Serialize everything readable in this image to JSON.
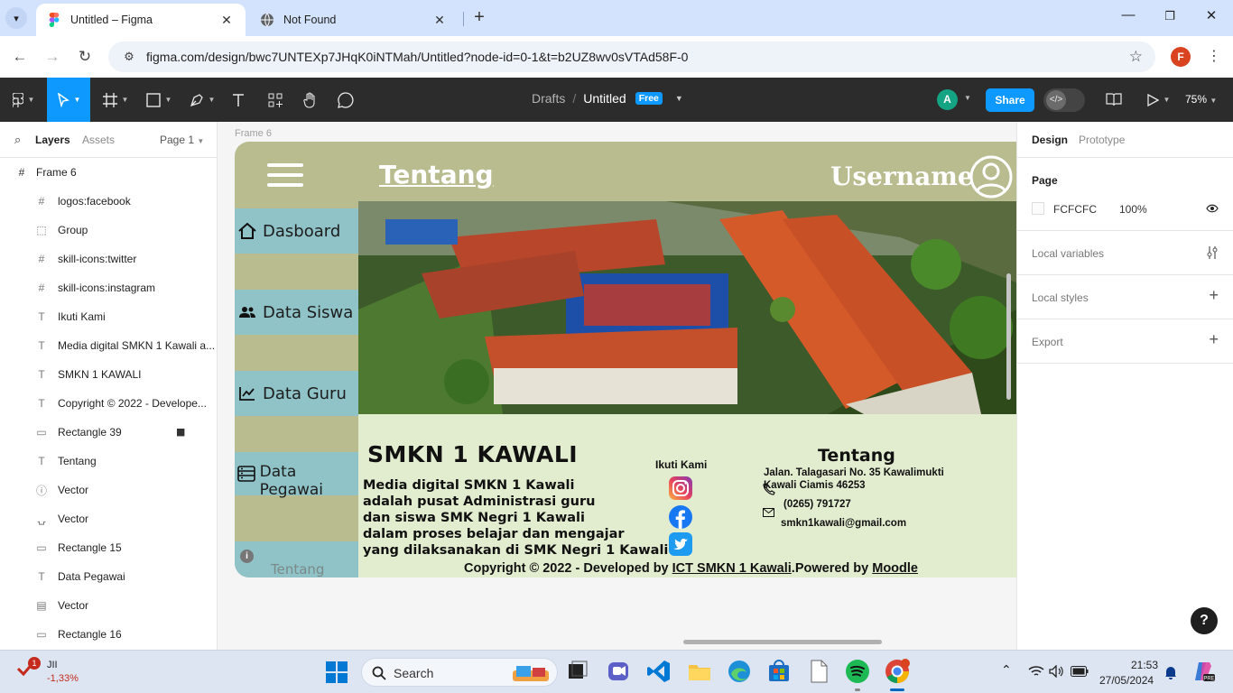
{
  "browser": {
    "tabs": [
      {
        "title": "Untitled – Figma",
        "active": true
      },
      {
        "title": "Not Found",
        "active": false
      }
    ],
    "url": "figma.com/design/bwc7UNTEXp7JHqK0iNTMah/Untitled?node-id=0-1&t=b2UZ8wv0sVTAd58F-0",
    "profile_initial": "F"
  },
  "figma_toolbar": {
    "breadcrumb_parent": "Drafts",
    "file_name": "Untitled",
    "plan_badge": "Free",
    "user_initial": "A",
    "share_label": "Share",
    "zoom": "75%"
  },
  "left_panel": {
    "tabs": {
      "layers": "Layers",
      "assets": "Assets"
    },
    "page_selector": "Page 1",
    "frame_name": "Frame 6",
    "layers": [
      {
        "icon": "frame-icon",
        "glyph": "#",
        "name": "logos:facebook"
      },
      {
        "icon": "group-icon",
        "glyph": "⬚",
        "name": "Group"
      },
      {
        "icon": "frame-icon",
        "glyph": "#",
        "name": "skill-icons:twitter"
      },
      {
        "icon": "frame-icon",
        "glyph": "#",
        "name": "skill-icons:instagram"
      },
      {
        "icon": "text-icon",
        "glyph": "T",
        "name": "Ikuti Kami"
      },
      {
        "icon": "text-icon",
        "glyph": "T",
        "name": "Media digital SMKN 1 Kawali a..."
      },
      {
        "icon": "text-icon",
        "glyph": "T",
        "name": "SMKN 1 KAWALI"
      },
      {
        "icon": "text-icon",
        "glyph": "T",
        "name": "Copyright © 2022 - Develope..."
      },
      {
        "icon": "rectangle-icon",
        "glyph": "▭",
        "name": "Rectangle 39",
        "locked": true
      },
      {
        "icon": "text-icon",
        "glyph": "T",
        "name": "Tentang"
      },
      {
        "icon": "vector-icon",
        "glyph": "ⓘ",
        "name": "Vector"
      },
      {
        "icon": "vector-icon",
        "glyph": "⍽",
        "name": "Vector"
      },
      {
        "icon": "rectangle-icon",
        "glyph": "▭",
        "name": "Rectangle 15"
      },
      {
        "icon": "text-icon",
        "glyph": "T",
        "name": "Data Pegawai"
      },
      {
        "icon": "vector-icon",
        "glyph": "▤",
        "name": "Vector"
      },
      {
        "icon": "rectangle-icon",
        "glyph": "▭",
        "name": "Rectangle 16"
      }
    ]
  },
  "canvas": {
    "frame_label": "Frame 6",
    "header": {
      "title": "Tentang",
      "username": "Username"
    },
    "menu": [
      "Dasboard",
      "Data Siswa",
      "Data Guru",
      "Data Pegawai",
      "Tentang"
    ],
    "footer": {
      "school": "SMKN 1 KAWALI",
      "description_lines": [
        "Media digital SMKN 1 Kawali",
        "adalah pusat Administrasi guru",
        "dan siswa SMK Negri 1 Kawali",
        "dalam proses belajar dan mengajar",
        "yang dilaksanakan di SMK Negri 1 Kawali"
      ],
      "follow_us": "Ikuti Kami",
      "about_heading": "Tentang",
      "address_line1": "Jalan. Talagasari No. 35 Kawalimukti",
      "address_line2": "Kawali Ciamis 46253",
      "phone": "(0265) 791727",
      "email": "smkn1kawali@gmail.com",
      "copyright_prefix": "Copyright © 2022 - Developed by ",
      "copyright_link": "ICT SMKN 1 Kawali",
      "copyright_mid": ".Powered by ",
      "copyright_link2": "Moodle"
    }
  },
  "right_panel": {
    "tabs": {
      "design": "Design",
      "prototype": "Prototype"
    },
    "page_heading": "Page",
    "page_color": "FCFCFC",
    "page_opacity": "100%",
    "sections": [
      "Local variables",
      "Local styles",
      "Export"
    ]
  },
  "taskbar": {
    "stock_name": "JII",
    "stock_badge": "1",
    "stock_change": "-1,33%",
    "search_label": "Search",
    "time": "21:53",
    "date": "27/05/2024"
  },
  "colors": {
    "figma_blue": "#0d99ff",
    "frame_bg": "#b8bc8f",
    "menu_bg": "#8fc3c8",
    "footer_bg": "#e2edd0"
  }
}
